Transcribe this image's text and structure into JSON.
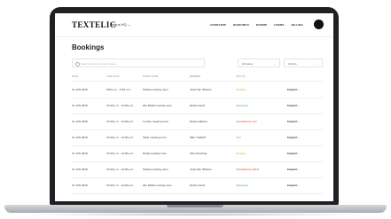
{
  "app": {
    "logo": "TEXTELIC",
    "org_selector": "Regus HQ ⌄",
    "nav": [
      "OVERVIEW",
      "BOOKINGS",
      "ROOMS",
      "USERS",
      "BILLING"
    ]
  },
  "page": {
    "title": "Bookings",
    "search_placeholder": "Search by user or room name",
    "filters": [
      {
        "label": "All status",
        "chevron": "⌄"
      },
      {
        "label": "All time",
        "chevron": "⌄"
      }
    ]
  },
  "table": {
    "columns": [
      "DATE",
      "TIME SLOT",
      "ROOM NAME",
      "MEMBER",
      "STATUS",
      ""
    ],
    "rows": [
      {
        "date": "21 JUN 2018",
        "time": "9:00 a.m. - 9:30 p.m.",
        "room": "Ottawa meeting room",
        "member": "Josef Van Wissem",
        "status": "Pending",
        "status_class": "st-pending",
        "action": "Expand ›"
      },
      {
        "date": "21 JUN 2018",
        "time": "10:00 p.m. - 12:00 p.m.",
        "room": "abu Dhabi meeting room",
        "member": "Robert Hood",
        "status": "Upcoming",
        "status_class": "st-upcoming",
        "action": "Expand ›"
      },
      {
        "date": "21 JUN 2018",
        "time": "10:00 p.m. - 12:00 p.m.",
        "room": "London meeting room",
        "member": "Daniel Haberer",
        "status": "Cancelled by user",
        "status_class": "st-cancel",
        "action": "Expand ›"
      },
      {
        "date": "21 JUN 2018",
        "time": "10:00 p.m. - 12:00 p.m.",
        "room": "Table meeting room",
        "member": "Mike Trollhoff",
        "status": "Past",
        "status_class": "st-past",
        "action": "Expand ›"
      },
      {
        "date": "21 JUN 2018",
        "time": "10:00 p.m. - 12:00 p.m.",
        "room": "Dubai meeting room",
        "member": "Alex Punching",
        "status": "Pending",
        "status_class": "st-pending",
        "action": "Expand ›"
      },
      {
        "date": "21 JUN 2018",
        "time": "10:00 p.m. - 12:00 p.m.",
        "room": "Ottawa meeting room",
        "member": "Josef Van Wissem",
        "status": "Cancelled by admin",
        "status_class": "st-cancel",
        "action": "Expand ›"
      },
      {
        "date": "21 JUN 2018",
        "time": "10:00 p.m. - 12:00 p.m.",
        "room": "abu Dhabi meeting room",
        "member": "Robert Hood",
        "status": "Upcoming",
        "status_class": "st-upcoming",
        "action": "Expand ›"
      }
    ]
  },
  "colors": {
    "pending": "#e8a21a",
    "upcoming": "#27a844",
    "cancelled": "#d9342b",
    "past": "#999999"
  }
}
